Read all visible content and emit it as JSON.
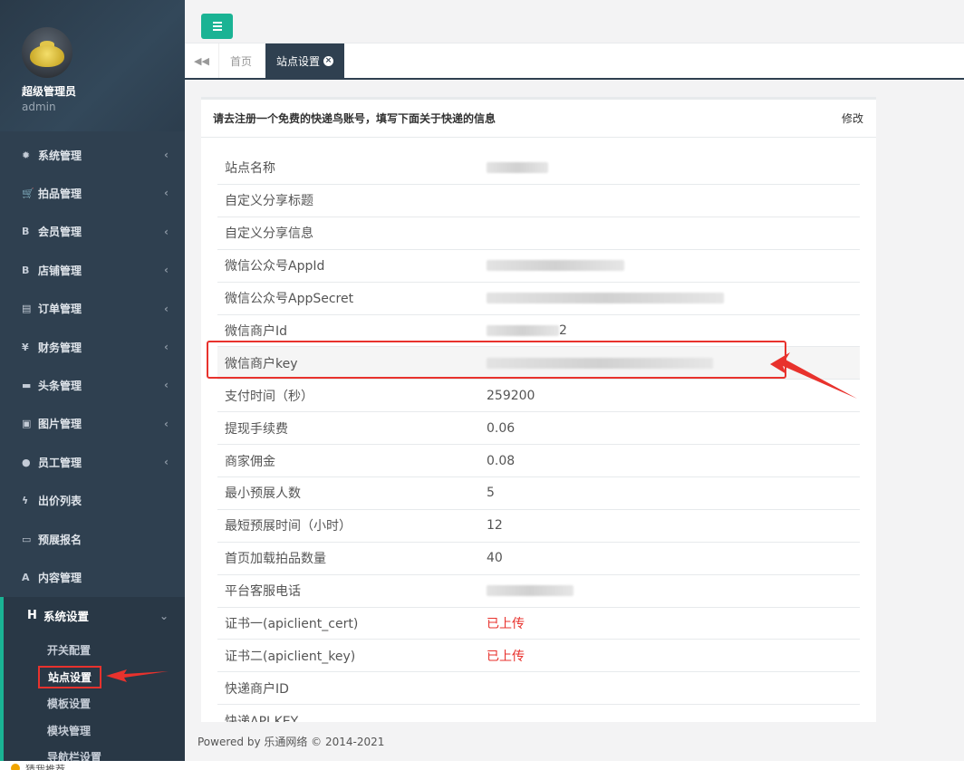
{
  "profile": {
    "name": "超级管理员",
    "role": "admin"
  },
  "menu": [
    {
      "icon": "✹",
      "icon_name": "gear-icon",
      "label": "系统管理",
      "arrow": "‹"
    },
    {
      "icon": "🛒",
      "icon_name": "cart-icon",
      "label": "拍品管理",
      "arrow": "‹"
    },
    {
      "icon": "B",
      "icon_name": "bold-b-icon",
      "label": "会员管理",
      "arrow": "‹"
    },
    {
      "icon": "B",
      "icon_name": "bold-b-icon",
      "label": "店铺管理",
      "arrow": "‹"
    },
    {
      "icon": "▤",
      "icon_name": "list-icon",
      "label": "订单管理",
      "arrow": "‹"
    },
    {
      "icon": "¥",
      "icon_name": "yen-icon",
      "label": "财务管理",
      "arrow": "‹"
    },
    {
      "icon": "▬",
      "icon_name": "folder-icon",
      "label": "头条管理",
      "arrow": "‹"
    },
    {
      "icon": "▣",
      "icon_name": "image-icon",
      "label": "图片管理",
      "arrow": "‹"
    },
    {
      "icon": "●",
      "icon_name": "user-icon",
      "label": "员工管理",
      "arrow": "‹"
    },
    {
      "icon": "ϟ",
      "icon_name": "bolt-icon",
      "label": "出价列表",
      "arrow": ""
    },
    {
      "icon": "▭",
      "icon_name": "card-icon",
      "label": "预展报名",
      "arrow": ""
    },
    {
      "icon": "A",
      "icon_name": "font-a-icon",
      "label": "内容管理",
      "arrow": ""
    }
  ],
  "active_menu": {
    "icon": "H",
    "label": "系统设置",
    "arrow": "⌄"
  },
  "submenu": [
    "开关配置",
    "站点设置",
    "模板设置",
    "模块管理",
    "导航栏设置"
  ],
  "tabs": {
    "home": "首页",
    "active": "站点设置",
    "close": "×"
  },
  "panel": {
    "heading": "请去注册一个免费的快递鸟账号，填写下面关于快递的信息",
    "edit": "修改"
  },
  "settings": [
    {
      "label": "站点名称",
      "value": ""
    },
    {
      "label": "自定义分享标题",
      "value": ""
    },
    {
      "label": "自定义分享信息",
      "value": ""
    },
    {
      "label": "微信公众号AppId",
      "value": ""
    },
    {
      "label": "微信公众号AppSecret",
      "value": ""
    },
    {
      "label": "微信商户Id",
      "value": "2"
    },
    {
      "label": "微信商户key",
      "value": ""
    },
    {
      "label": "支付时间（秒）",
      "value": "259200"
    },
    {
      "label": "提现手续费",
      "value": "0.06"
    },
    {
      "label": "商家佣金",
      "value": "0.08"
    },
    {
      "label": "最小预展人数",
      "value": "5"
    },
    {
      "label": "最短预展时间（小时）",
      "value": "12"
    },
    {
      "label": "首页加载拍品数量",
      "value": "40"
    },
    {
      "label": "平台客服电话",
      "value": ""
    },
    {
      "label": "证书一(apiclient_cert)",
      "value": "已上传",
      "red": true
    },
    {
      "label": "证书二(apiclient_key)",
      "value": "已上传",
      "red": true
    },
    {
      "label": "快递商户ID",
      "value": ""
    },
    {
      "label": "快递API KEY",
      "value": ""
    }
  ],
  "footer": "Powered by 乐通网络 © 2014-2021",
  "bottom_strip": "猜我推荐"
}
